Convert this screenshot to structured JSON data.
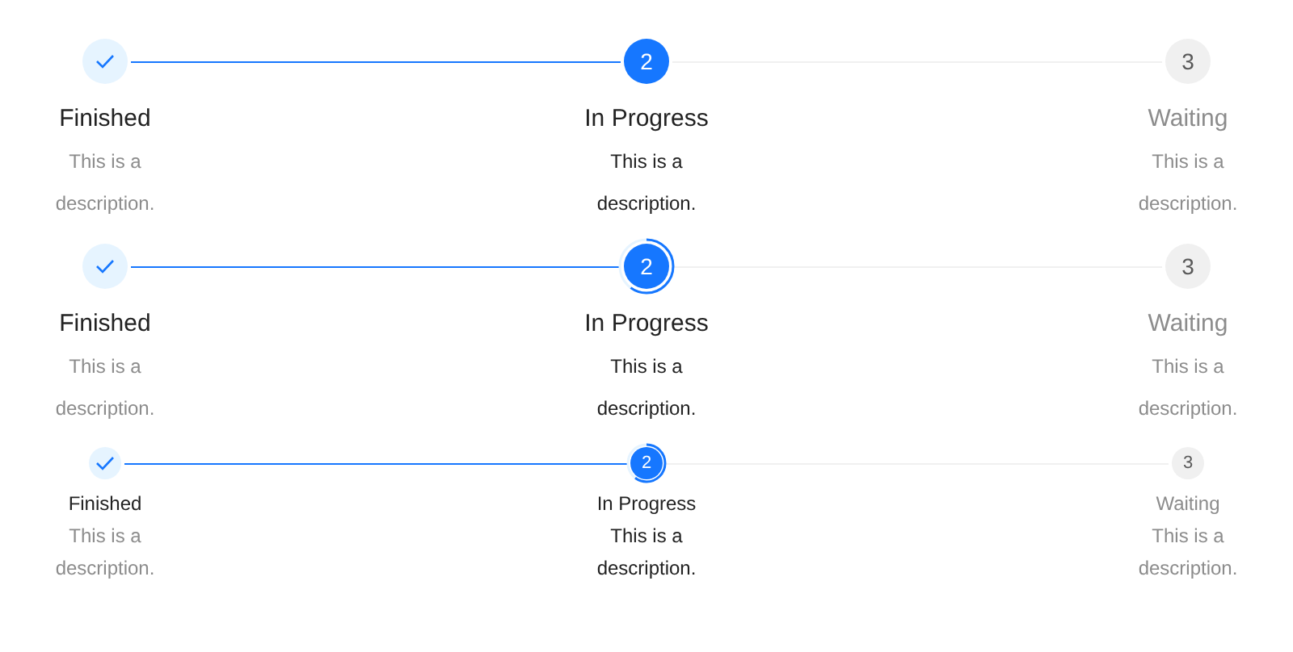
{
  "step_bars": [
    {
      "kind": "default",
      "steps": [
        {
          "kind": "finish",
          "title": "Finished",
          "description": "This is a description."
        },
        {
          "kind": "process",
          "number": "2",
          "title": "In Progress",
          "description": "This is a description."
        },
        {
          "kind": "wait",
          "number": "3",
          "title": "Waiting",
          "description": "This is a description."
        }
      ]
    },
    {
      "kind": "progress",
      "steps": [
        {
          "kind": "finish",
          "title": "Finished",
          "description": "This is a description."
        },
        {
          "kind": "process",
          "number": "2",
          "title": "In Progress",
          "description": "This is a description."
        },
        {
          "kind": "wait",
          "number": "3",
          "title": "Waiting",
          "description": "This is a description."
        }
      ]
    },
    {
      "kind": "small_progress",
      "steps": [
        {
          "kind": "finish",
          "title": "Finished",
          "description": "This is a description."
        },
        {
          "kind": "process",
          "number": "2",
          "title": "In Progress",
          "description": "This is a description."
        },
        {
          "kind": "wait",
          "number": "3",
          "title": "Waiting",
          "description": "This is a description."
        }
      ]
    }
  ]
}
